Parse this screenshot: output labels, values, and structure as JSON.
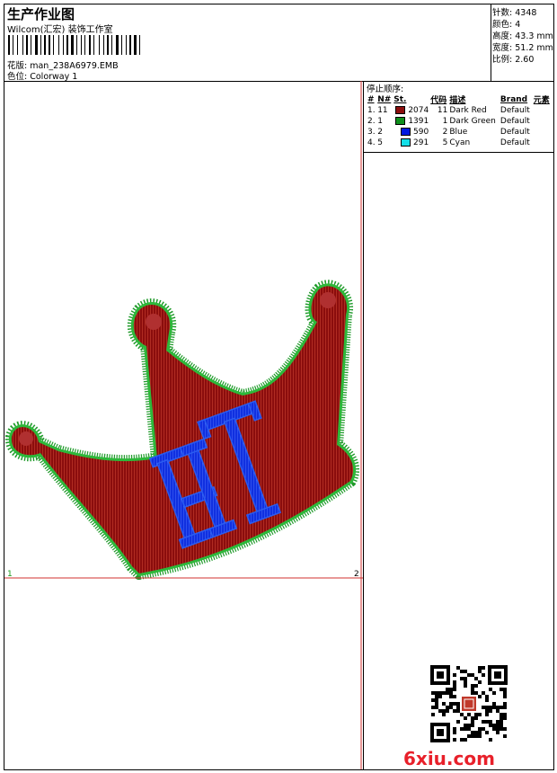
{
  "header": {
    "title": "生产作业图",
    "company": "Wilcom(汇宏) 装饰工作室",
    "design_file_label": "花版:",
    "design_file": "man_238A6979.EMB",
    "colorway_label": "色位:",
    "colorway": "Colorway 1"
  },
  "stats": [
    {
      "label": "针数:",
      "value": "4348"
    },
    {
      "label": "颜色:",
      "value": "4"
    },
    {
      "label": "高度:",
      "value": "43.3 mm"
    },
    {
      "label": "宽度:",
      "value": "51.2 mm"
    },
    {
      "label": "比例:",
      "value": "2.60"
    }
  ],
  "color_sequence": {
    "title": "停止顺序:",
    "headers": [
      "#",
      "N#",
      "St.",
      "代码",
      "描述",
      "Brand",
      "元素"
    ],
    "rows": [
      {
        "idx": "1.",
        "n": "11",
        "color": "#8b0d0d",
        "st": "2074",
        "code": "11",
        "desc": "Dark Red",
        "brand": "Default"
      },
      {
        "idx": "2.",
        "n": "1",
        "color": "#0f8f1c",
        "st": "1391",
        "code": "1",
        "desc": "Dark Green",
        "brand": "Default"
      },
      {
        "idx": "3.",
        "n": "2",
        "color": "#0018e0",
        "st": "590",
        "code": "2",
        "desc": "Blue",
        "brand": "Default"
      },
      {
        "idx": "4.",
        "n": "5",
        "color": "#14dfe8",
        "st": "291",
        "code": "5",
        "desc": "Cyan",
        "brand": "Default"
      }
    ]
  },
  "canvas": {
    "marker_left": "1",
    "marker_right": "2",
    "marker_bottom": "3",
    "axis_color": "#d0302f",
    "marker_left_color": "#1a9a1a"
  },
  "design": {
    "fill_color": "#8b0d0d",
    "border_color": "#1f9a2a",
    "letter_color": "#1030e0",
    "letter_outline_color": "#2a5cf0",
    "letters": "HT"
  },
  "watermark": {
    "text": "6xiu.com",
    "color": "#e8202a"
  }
}
